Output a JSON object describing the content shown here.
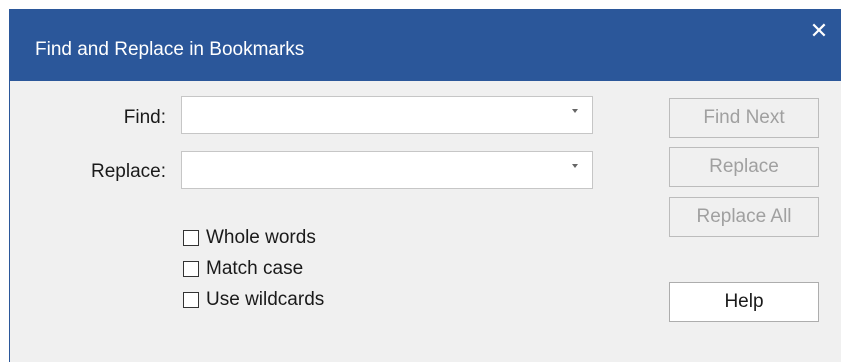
{
  "dialog": {
    "title": "Find and Replace in Bookmarks",
    "close_glyph": "✕"
  },
  "find": {
    "label": "Find:",
    "value": ""
  },
  "replace": {
    "label": "Replace:",
    "value": ""
  },
  "options": {
    "whole_words": {
      "label": "Whole words",
      "checked": false
    },
    "match_case": {
      "label": "Match case",
      "checked": false
    },
    "use_wildcards": {
      "label": "Use wildcards",
      "checked": false
    }
  },
  "buttons": {
    "find_next": "Find Next",
    "replace": "Replace",
    "replace_all": "Replace All",
    "help": "Help"
  },
  "colors": {
    "titlebar": "#2b579a",
    "dialog_bg": "#f0f0f0",
    "disabled_text": "#a0a0a0"
  }
}
